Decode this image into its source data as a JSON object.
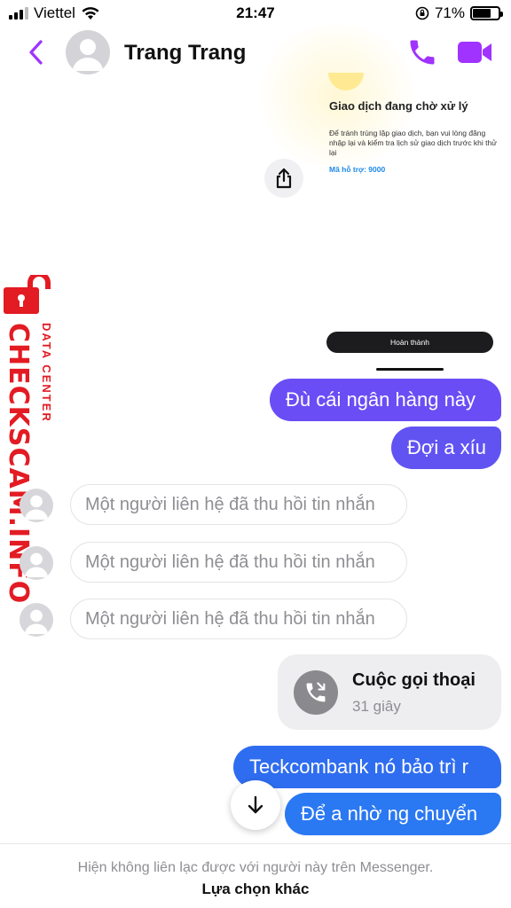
{
  "status_bar": {
    "carrier": "Viettel",
    "time": "21:47",
    "battery_percent": "71%",
    "battery_level": 0.71
  },
  "header": {
    "contact_name": "Trang Trang",
    "back_icon": "chevron-left-icon",
    "call_icon": "phone-icon",
    "video_icon": "video-camera-icon",
    "accent_color": "#a033ff"
  },
  "shared_image": {
    "title": "Giao dịch đang chờ xử lý",
    "description": "Để tránh trùng lặp giao dịch, bạn vui lòng đăng nhập lại và kiểm tra lịch sử giao dịch trước khi thử lại",
    "support_code": "Mã hỗ trợ: 9000",
    "done_button": "Hoàn thành",
    "share_icon": "share-icon"
  },
  "watermark": {
    "main": "CHECKSCAM.INFO",
    "sub": "DATA CENTER",
    "color": "#e31b23"
  },
  "messages": {
    "sent_1": "Đù cái ngân hàng này",
    "sent_2": "Đợi a xíu",
    "recalled": [
      "Một người liên hệ đã thu hồi tin nhắn",
      "Một người liên hệ đã thu hồi tin nhắn",
      "Một người liên hệ đã thu hồi tin nhắn"
    ],
    "call": {
      "title": "Cuộc gọi thoại",
      "duration": "31 giây"
    },
    "sent_3": "Teckcombank nó bảo trì r",
    "sent_4": "Để a nhờ ng chuyển"
  },
  "footer": {
    "notice": "Hiện không liên lạc được với người này trên Messenger.",
    "link": "Lựa chọn khác"
  }
}
